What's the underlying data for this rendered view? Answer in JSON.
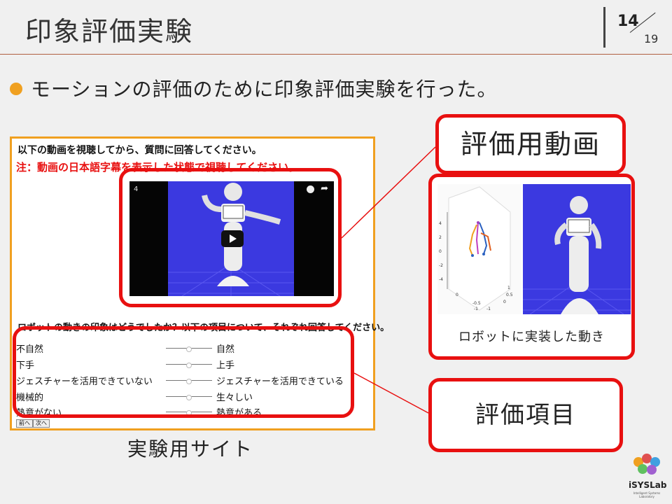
{
  "slide": {
    "title": "印象評価実験",
    "page_current": "14",
    "page_total": "19",
    "bullet": "モーションの評価のために印象評価実験を行った。"
  },
  "site": {
    "question1": "以下の動画を視聴してから、質問に回答してください。",
    "note": "注：動画の日本語字幕を表示した状態で視聴してください。",
    "video_number": "4",
    "question2": "ロボットの動きの印象はどうでしたか？以下の項目について、それぞれ回答してください。",
    "scales": [
      {
        "left": "不自然",
        "right": "自然"
      },
      {
        "left": "下手",
        "right": "上手"
      },
      {
        "left": "ジェスチャーを活用できていない",
        "right": "ジェスチャーを活用できている"
      },
      {
        "left": "機械的",
        "right": "生々しい"
      },
      {
        "left": "熱意がない",
        "right": "熱意がある"
      }
    ],
    "prev_button": "前へ",
    "next_button": "次へ",
    "caption": "実験用サイト"
  },
  "callouts": {
    "video_label": "評価用動画",
    "items_label": "評価項目",
    "robot_caption": "ロボットに実装した動き"
  },
  "plot3d": {
    "y_ticks": [
      "4",
      "2",
      "0",
      "-2",
      "-4"
    ],
    "x_ticks": [
      "0",
      "-0.5",
      "-1"
    ],
    "z_ticks": [
      "1",
      "0.5",
      "0",
      "-1"
    ]
  },
  "logo": {
    "name": "iSYSLab",
    "sub": "Intelligent Systems Laboratory"
  },
  "colors": {
    "accent_red": "#e81010",
    "accent_orange": "#f0a020",
    "video_bg": "#3b39e0"
  }
}
